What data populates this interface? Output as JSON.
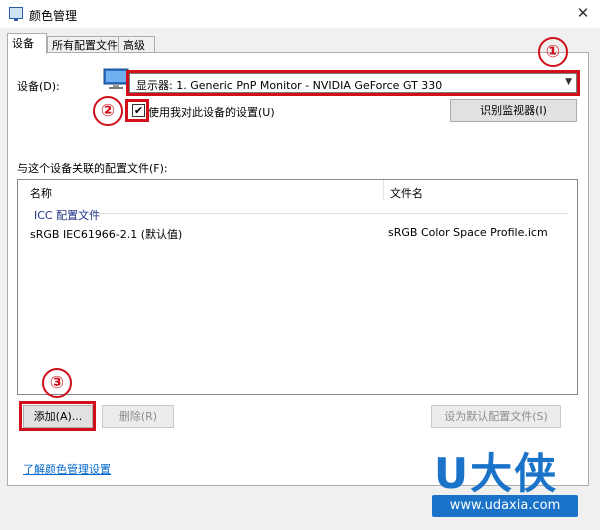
{
  "window": {
    "title": "颜色管理",
    "close_symbol": "✕"
  },
  "tabs": [
    {
      "label": "设备",
      "active": true
    },
    {
      "label": "所有配置文件",
      "active": false
    },
    {
      "label": "高级",
      "active": false
    }
  ],
  "device": {
    "label": "设备(D):",
    "selected": "显示器: 1. Generic PnP Monitor - NVIDIA GeForce GT 330",
    "dropdown_arrow": "▼",
    "use_settings_label": "使用我对此设备的设置(U)",
    "use_settings_checked": true,
    "check_mark": "✔",
    "identify_button": "识别监视器(I)"
  },
  "profiles": {
    "label": "与这个设备关联的配置文件(F):",
    "columns": [
      "名称",
      "文件名"
    ],
    "group_label": "ICC 配置文件",
    "rows": [
      {
        "name": "sRGB IEC61966-2.1 (默认值)",
        "file": "sRGB Color Space Profile.icm"
      }
    ]
  },
  "buttons": {
    "add": "添加(A)...",
    "remove": "删除(R)",
    "set_default": "设为默认配置文件(S)"
  },
  "learn_link": "了解颜色管理设置",
  "annotations": [
    "①",
    "②",
    "③"
  ],
  "watermark": {
    "text": "U大侠",
    "url": "www.udaxia.com"
  },
  "colors": {
    "annotation": "#d0111b",
    "watermark": "#1a73c9",
    "link": "#0066cc",
    "group": "#1e3287"
  },
  "icons": [
    "display-icon",
    "monitor-icon",
    "close-icon",
    "chevron-down-icon",
    "checkmark-icon"
  ]
}
